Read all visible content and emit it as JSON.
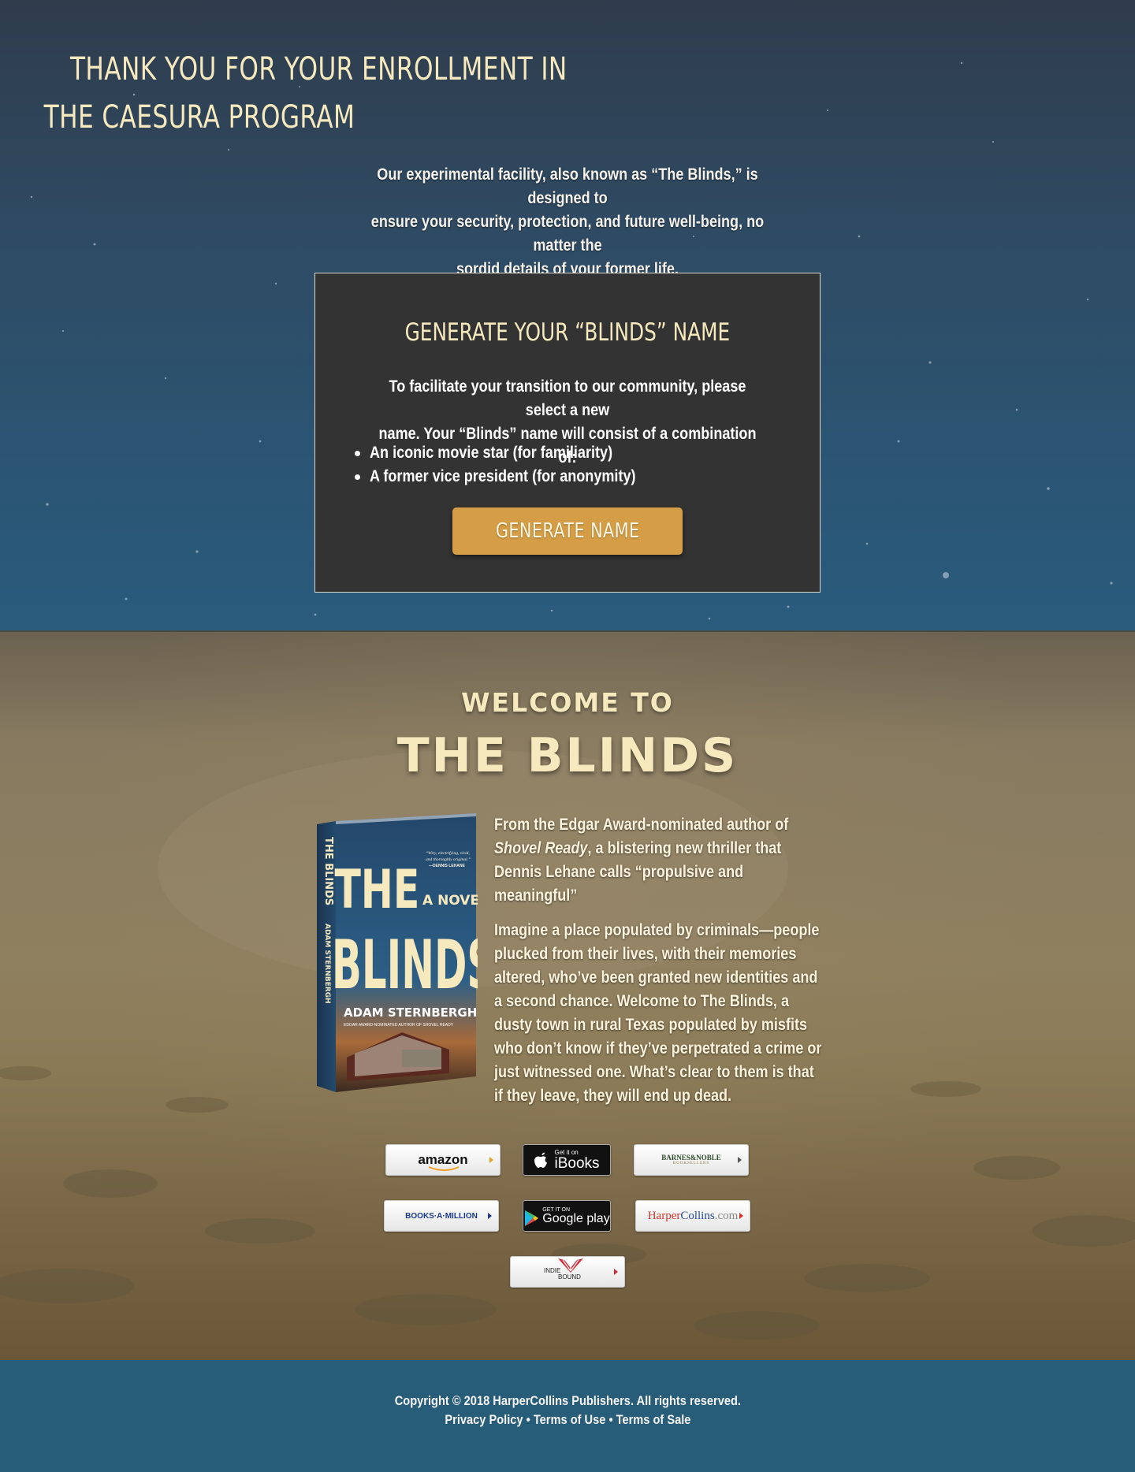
{
  "header": {
    "headline_line1": "THANK YOU FOR YOUR ENROLLMENT IN",
    "headline_line2": "THE CAESURA PROGRAM",
    "intro_line1": "Our experimental facility, also known as “The Blinds,” is designed to",
    "intro_line2": "ensure your security, protection, and future well-being, no matter the",
    "intro_line3": "sordid details of your former life."
  },
  "generator": {
    "title": "GENERATE YOUR “BLINDS” NAME",
    "text_line1": "To facilitate your transition to our community, please select a new",
    "text_line2": "name. Your “Blinds” name will consist of a combination of:",
    "bullets": [
      "An iconic movie star (for familiarity)",
      "A former vice president (for anonymity)"
    ],
    "button_label": "GENERATE NAME"
  },
  "welcome": {
    "small": "WELCOME TO",
    "big": "THE BLINDS"
  },
  "book": {
    "cover_title_1": "THE",
    "cover_title_2": "BLINDS",
    "cover_subtitle": "A NOVEL",
    "cover_author": "ADAM STERNBERGH",
    "cover_tagline": "EDGAR AWARD-NOMINATED AUTHOR OF SHOVEL READY",
    "cover_quote": "“Wiry, electrifying, vivid, and thoroughly original.” —DENNIS LEHANE",
    "spine_title": "THE BLINDS",
    "spine_author": "ADAM STERNBERGH"
  },
  "blurb": {
    "p1_before": "From the Edgar Award-nominated author of ",
    "p1_em": "Shovel Ready",
    "p1_after": ", a blistering new thriller that Dennis Lehane calls “propulsive and meaningful”",
    "p2": "Imagine a place populated by criminals—people plucked from their lives, with their memories altered, who’ve been granted new identities and a second chance. Welcome to The Blinds, a dusty town in rural Texas populated by misfits who don’t know if they’ve perpetrated a crime or just witnessed one. What’s clear to them is that if they leave, they will end up dead."
  },
  "retailers": {
    "amazon": "amazon",
    "ibooks_small": "Get it on",
    "ibooks_big": "iBooks",
    "bn_1": "BARNES&NOBLE",
    "bn_2": "BOOKSELLERS",
    "bam": "BOOKS·A·MILLION",
    "gp_small": "GET IT ON",
    "gp_big": "Google play",
    "hc_1": "Harper",
    "hc_2": "Collins",
    "hc_3": ".com",
    "indie_1": "INDIE",
    "indie_2": "BOUND"
  },
  "footer": {
    "copyright": "Copyright © 2018 HarperCollins Publishers. All rights reserved.",
    "privacy": "Privacy Policy",
    "terms_use": "Terms of Use",
    "terms_sale": "Terms of Sale",
    "separator": "•"
  },
  "colors": {
    "cream": "#f6e9bd",
    "button": "#d59d45",
    "panel": "#333333",
    "footer": "#285d79"
  }
}
